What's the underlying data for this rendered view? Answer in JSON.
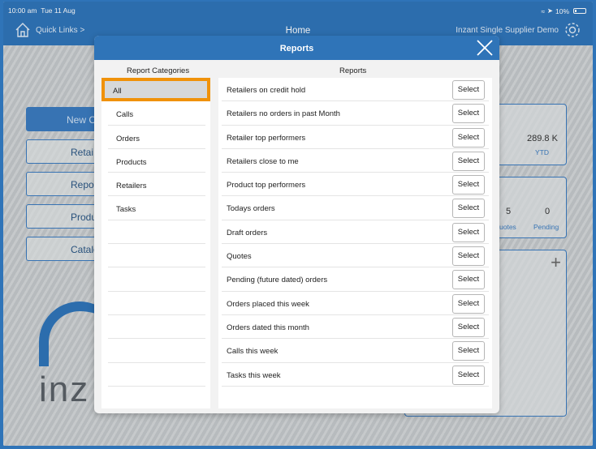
{
  "status_bar": {
    "time": "10:00 am",
    "date": "Tue 11 Aug",
    "battery": "10%"
  },
  "nav": {
    "quick_links": "Quick Links >",
    "title": "Home",
    "company": "Inzant Single Supplier Demo"
  },
  "background": {
    "primary_button": "New C",
    "buttons": [
      "Retai",
      "Repo",
      "Produ",
      "Catalo"
    ],
    "stat_ytd_value": "289.8 K",
    "stat_ytd_label": "YTD",
    "quotes_value": "5",
    "quotes_label": "uotes",
    "pending_value": "0",
    "pending_label": "Pending",
    "logo_text": "inz"
  },
  "modal": {
    "title": "Reports",
    "categories_header": "Report Categories",
    "reports_header": "Reports",
    "categories": [
      "All",
      "Calls",
      "Orders",
      "Products",
      "Retailers",
      "Tasks"
    ],
    "selected_category": "All",
    "select_label": "Select",
    "reports": [
      "Retailers on credit hold",
      "Retailers no orders in past Month",
      "Retailer top performers",
      "Retailers close to me",
      "Product top performers",
      "Todays orders",
      "Draft orders",
      "Quotes",
      "Pending (future dated) orders",
      "Orders placed this week",
      "Orders dated this month",
      "Calls this week",
      "Tasks this week"
    ]
  },
  "colors": {
    "brand": "#2f74b8",
    "highlight": "#f0920a"
  }
}
